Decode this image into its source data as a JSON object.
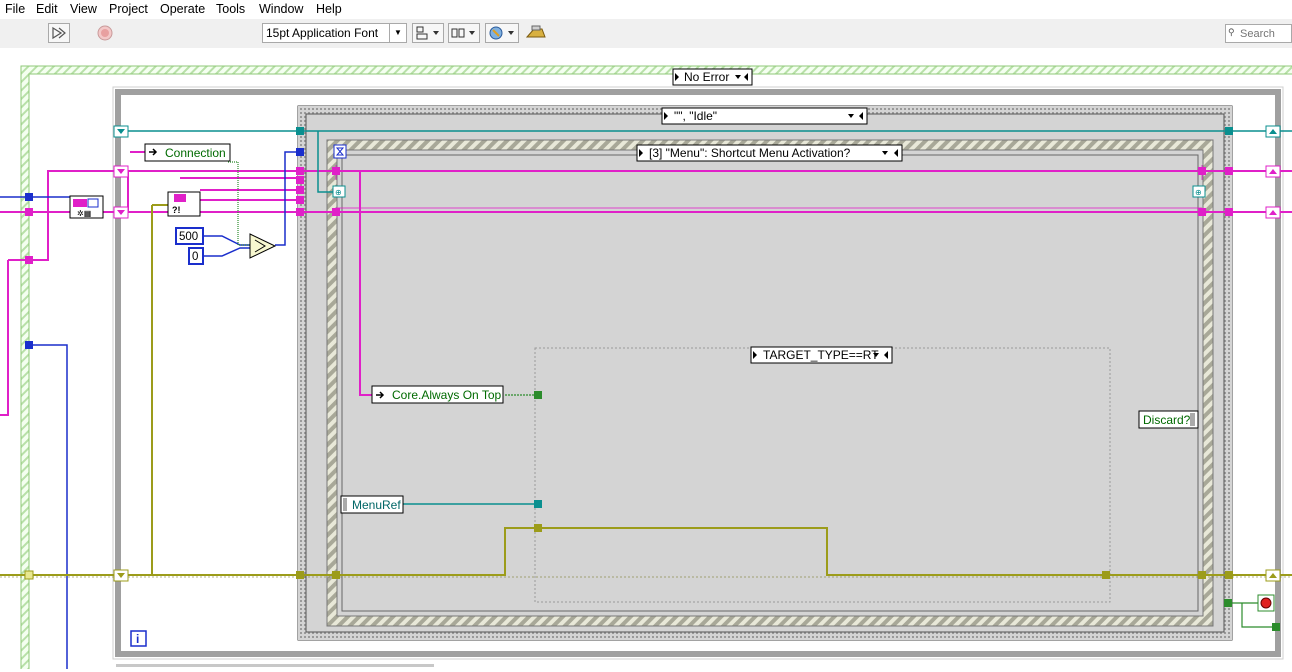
{
  "menu": [
    "File",
    "Edit",
    "View",
    "Project",
    "Operate",
    "Tools",
    "Window",
    "Help"
  ],
  "toolbar": {
    "font": "15pt Application Font",
    "search_placeholder": "Search",
    "icons": [
      "clean-up-icon",
      "abort-icon",
      "align-icon",
      "distribute-icon",
      "reorder-icon",
      "highlight-icon"
    ]
  },
  "diagram": {
    "error_case_selector": "No Error",
    "state_case_selector": "\"\", \"Idle\"",
    "event_case_selector": "[3] \"Menu\": Shortcut Menu Activation?",
    "conditional_selector": "TARGET_TYPE==RT",
    "connection_label": "Connection",
    "always_on_top_label": "Core.Always On Top",
    "menuref_label": "MenuRef",
    "discard_label": "Discard?",
    "constant_500": "500",
    "constant_0": "0",
    "info_label": "i"
  },
  "colors": {
    "pink_wire": "#e020c8",
    "teal_wire": "#0a8f8f",
    "blue_wire": "#1a2ecc",
    "error_wire": "#9c9c1a",
    "green_wire": "#2c8c2c",
    "frame_gray": "#b8b8b8"
  }
}
